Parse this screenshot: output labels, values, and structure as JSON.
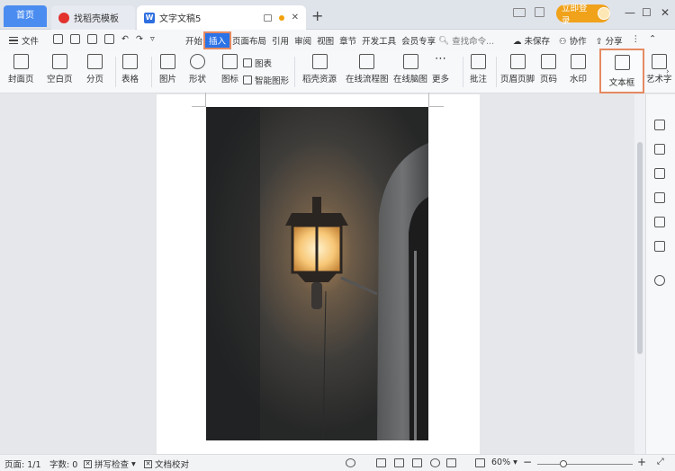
{
  "titlebar": {
    "home_tab": "首页",
    "tabs": [
      {
        "label": "找稻壳模板",
        "icon": "docer-icon"
      },
      {
        "label": "文字文稿5",
        "icon": "wps-writer-icon"
      }
    ],
    "writer_icon_glyph": "W",
    "new_tab": "+",
    "login_label": "立即登录",
    "window_controls": [
      "minimize",
      "maximize",
      "close"
    ]
  },
  "menubar": {
    "file_label": "文件",
    "items": [
      "开始",
      "插入",
      "页面布局",
      "引用",
      "审阅",
      "视图",
      "章节",
      "开发工具",
      "会员专享"
    ],
    "active_item": "插入",
    "search_placeholder": "查找命令...",
    "unsaved": "未保存",
    "collab": "协作",
    "share": "分享"
  },
  "ribbon": {
    "cover": "封面页",
    "blank": "空白页",
    "page_break": "分页",
    "table": "表格",
    "picture": "图片",
    "shape": "形状",
    "icon": "图标",
    "chart": "图表",
    "smart_art": "智能图形",
    "docer_resources": "稻壳资源",
    "flowchart": "在线流程图",
    "mindmap": "在线脑图",
    "more": "更多",
    "comment": "批注",
    "header_footer": "页眉页脚",
    "page_number": "页码",
    "watermark": "水印",
    "textbox": "文本框",
    "wordart": "艺术字"
  },
  "statusbar": {
    "page": "页面: 1/1",
    "words": "字数: 0",
    "spell_check": "拼写检查",
    "doc_proof": "文档校对",
    "zoom": "60%",
    "zoom_out": "−",
    "zoom_in": "+"
  },
  "colors": {
    "accent": "#2b72e6",
    "highlight_outline": "#e58a62",
    "login": "#f0a21b"
  }
}
